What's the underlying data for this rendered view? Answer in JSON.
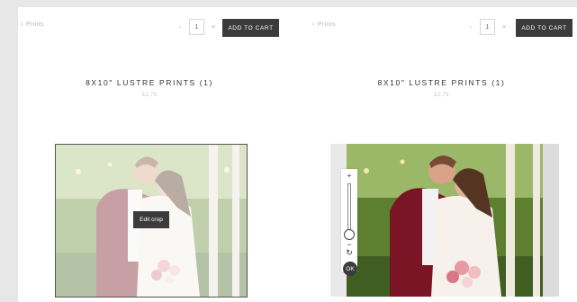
{
  "left": {
    "back_label": "Prints",
    "quantity": "1",
    "minus": "-",
    "plus": "+",
    "add_to_cart": "ADD TO CART",
    "title": "8X10\" LUSTRE PRINTS (1)",
    "price": "£2.75",
    "edit_crop": "Edit crop"
  },
  "right": {
    "back_label": "Prints",
    "quantity": "1",
    "minus": "-",
    "plus": "+",
    "add_to_cart": "ADD TO CART",
    "title": "8X10\" LUSTRE PRINTS (1)",
    "price": "£2.75",
    "zoom_in": "+",
    "zoom_out": "−",
    "ok": "OK"
  },
  "icons": {
    "back": "chevron-left-icon",
    "rotate": "rotate-icon"
  },
  "colors": {
    "button": "#3b3b3b",
    "page_bg": "#e7e7e7"
  }
}
